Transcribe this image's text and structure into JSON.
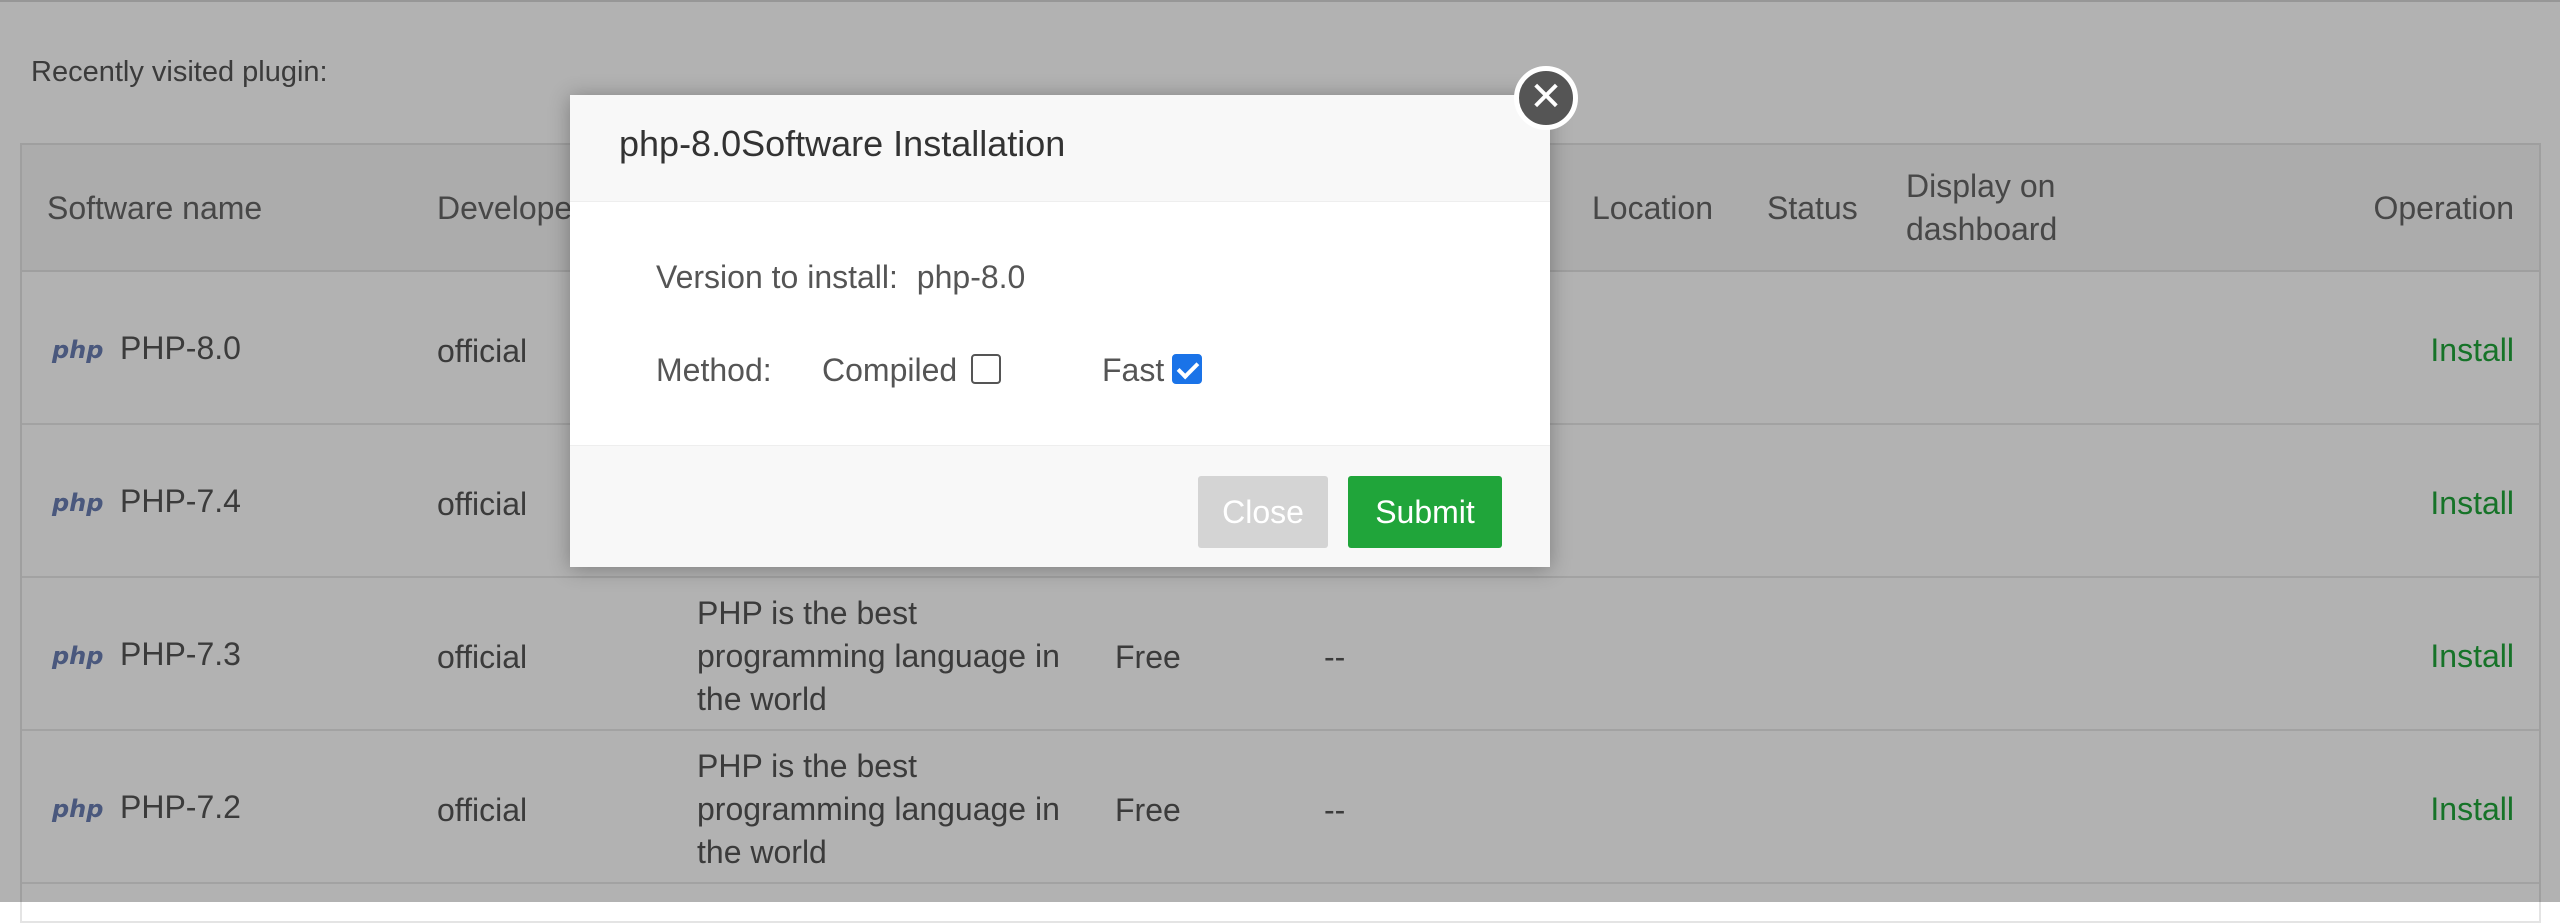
{
  "recent_label": "Recently visited plugin:",
  "table": {
    "headers": {
      "name": "Software name",
      "developer": "Developer",
      "location": "Location",
      "status": "Status",
      "display_line1": "Display on",
      "display_line2": "dashboard",
      "operation": "Operation"
    },
    "rows": [
      {
        "name": "PHP-8.0",
        "developer": "official",
        "desc": [
          "",
          "",
          ""
        ],
        "price": "",
        "expire": "",
        "operation": "Install"
      },
      {
        "name": "PHP-7.4",
        "developer": "official",
        "desc": [
          "",
          "",
          ""
        ],
        "price": "",
        "expire": "",
        "operation": "Install"
      },
      {
        "name": "PHP-7.3",
        "developer": "official",
        "desc": [
          "PHP is the best",
          "programming language in",
          "the world"
        ],
        "price": "Free",
        "expire": "--",
        "operation": "Install"
      },
      {
        "name": "PHP-7.2",
        "developer": "official",
        "desc": [
          "PHP is the best",
          "programming language in",
          "the world"
        ],
        "price": "Free",
        "expire": "--",
        "operation": "Install"
      }
    ],
    "logo_text": "php"
  },
  "modal": {
    "title": "php-8.0Software Installation",
    "version_label": "Version to install:",
    "version_value": "php-8.0",
    "method_label": "Method:",
    "option_compiled": "Compiled",
    "option_fast": "Fast",
    "compiled_checked": false,
    "fast_checked": true,
    "close_button": "Close",
    "submit_button": "Submit",
    "close_icon": "✕"
  },
  "colors": {
    "accent_green": "#20a53a",
    "checkbox_blue": "#1a73e8"
  }
}
